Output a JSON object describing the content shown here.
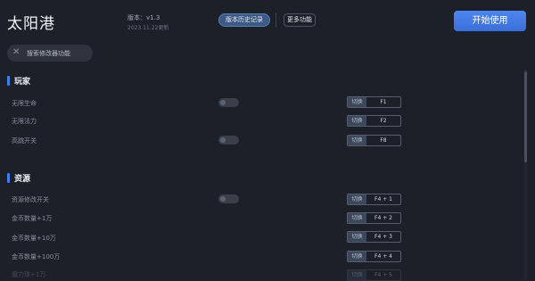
{
  "header": {
    "title": "太阳港",
    "version": "版本：v1.3",
    "date": "2023.11.22更新",
    "history_button": "版本历史记录",
    "more_button": "更多功能",
    "start_button": "开始使用"
  },
  "search": {
    "icon": "close-icon",
    "label": "搜索修改器功能"
  },
  "sections": [
    {
      "title": "玩家",
      "rows": [
        {
          "label": "无限生命",
          "switch_label": "切换",
          "key": "F1"
        },
        {
          "label": "无限法力",
          "switch_label": "切换",
          "key": "F2"
        },
        {
          "label": "高跳开关",
          "switch_label": "切换",
          "key": "F8"
        }
      ]
    },
    {
      "title": "资源",
      "rows": [
        {
          "label": "资源修改开关",
          "switch_label": "切换",
          "key": "F4 + 1"
        },
        {
          "label": "金币数量+1万",
          "switch_label": "切换",
          "key": "F4 + 2"
        },
        {
          "label": "金币数量+10万",
          "switch_label": "切换",
          "key": "F4 + 3"
        },
        {
          "label": "金币数量+100万",
          "switch_label": "切换",
          "key": "F4 + 4"
        },
        {
          "label": "魔力球+1万",
          "switch_label": "切换",
          "key": "F4 + 5"
        }
      ]
    }
  ],
  "colors": {
    "background": "#1c2029",
    "accent": "#3f7df0",
    "start_button": "#4a80ea"
  }
}
